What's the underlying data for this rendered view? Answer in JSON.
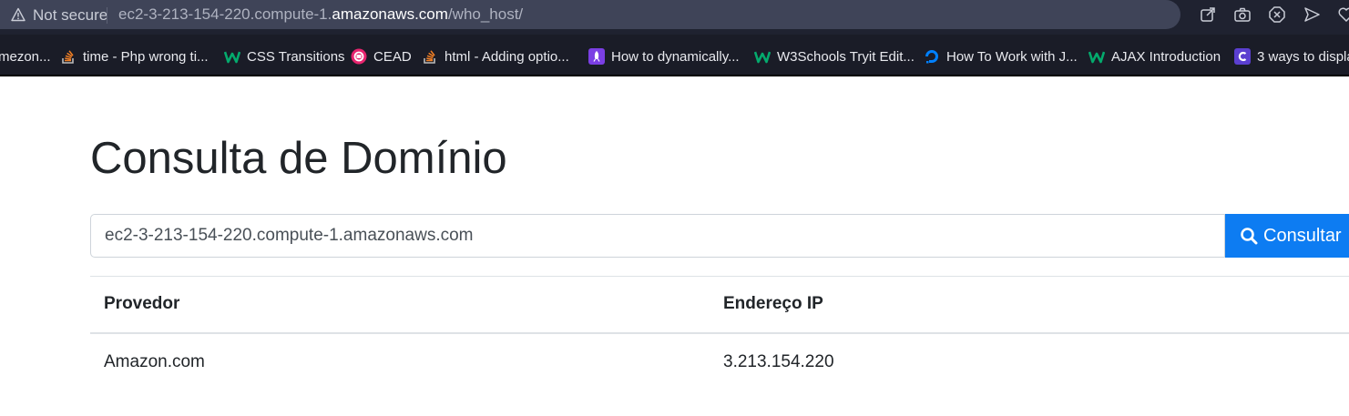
{
  "browser": {
    "security_label": "Not secure",
    "url_prefix": "ec2-3-213-154-220.compute-1.",
    "url_domain": "amazonaws.com",
    "url_path": "/who_host/"
  },
  "bookmarks": [
    {
      "label": "mezon..."
    },
    {
      "label": "time - Php wrong ti..."
    },
    {
      "label": "CSS Transitions"
    },
    {
      "label": "CEAD"
    },
    {
      "label": "html - Adding optio..."
    },
    {
      "label": "How to dynamically..."
    },
    {
      "label": "W3Schools Tryit Edit..."
    },
    {
      "label": "How To Work with J..."
    },
    {
      "label": "AJAX Introduction"
    },
    {
      "label": "3 ways to displa"
    }
  ],
  "page": {
    "title": "Consulta de Domínio",
    "search": {
      "value": "ec2-3-213-154-220.compute-1.amazonaws.com",
      "button_label": "Consultar"
    },
    "table": {
      "headers": [
        "Provedor",
        "Endereço IP"
      ],
      "rows": [
        [
          "Amazon.com",
          "3.213.154.220"
        ]
      ]
    }
  },
  "colors": {
    "primary": "#0d7cf2",
    "text": "#212529"
  }
}
